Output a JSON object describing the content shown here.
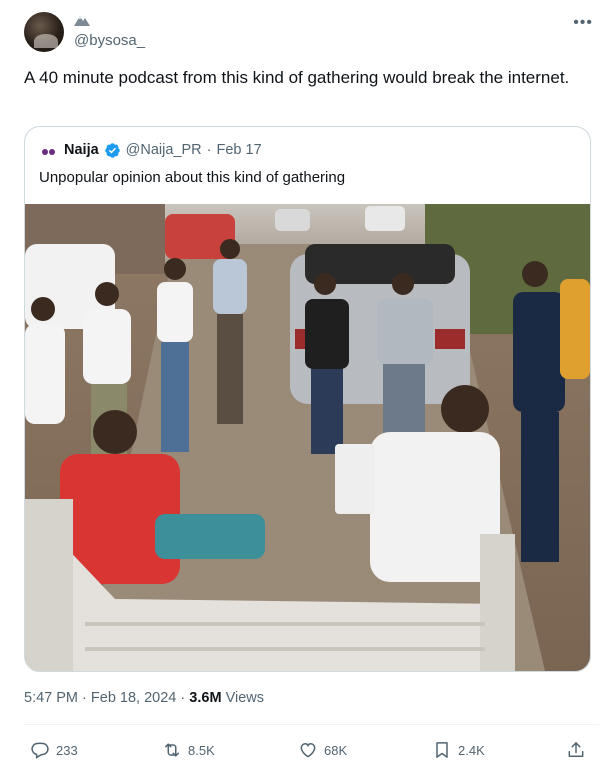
{
  "author": {
    "handle": "@bysosa_",
    "name_emoji": "mountain-emoji"
  },
  "more_icon": "more-horizontal-icon",
  "tweet": {
    "text": "A 40 minute podcast from this kind of gathering would break the internet."
  },
  "quoted": {
    "name": "Naija",
    "handle": "@Naija_PR",
    "separator": "·",
    "date": "Feb 17",
    "text": "Unpopular opinion about this kind of gathering",
    "verified_color": "#1d9bf0"
  },
  "meta": {
    "time": "5:47 PM",
    "separator": "·",
    "date": "Feb 18, 2024",
    "separator2": "·",
    "views_count": "3.6M",
    "views_label": "Views"
  },
  "actions": {
    "replies": "233",
    "reposts": "8.5K",
    "likes": "68K",
    "bookmarks": "2.4K"
  },
  "colors": {
    "text_primary": "#0f1419",
    "text_secondary": "#536471",
    "border": "#cfd9de"
  }
}
